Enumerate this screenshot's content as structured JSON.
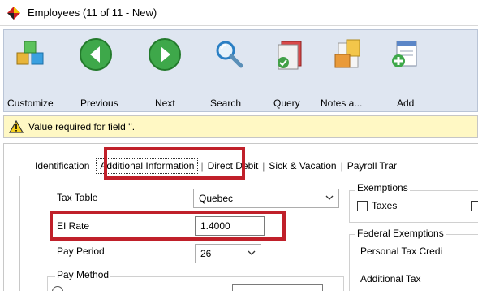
{
  "window": {
    "title": "Employees (11 of 11 - New)"
  },
  "toolbar": {
    "buttons": [
      {
        "label": "Customize",
        "icon": "cubes-icon"
      },
      {
        "label": "Previous",
        "icon": "arrow-left-icon"
      },
      {
        "label": "Next",
        "icon": "arrow-right-icon"
      },
      {
        "label": "Search",
        "icon": "magnifier-icon"
      },
      {
        "label": "Query",
        "icon": "query-icon"
      },
      {
        "label": "Notes a...",
        "icon": "notes-icon"
      },
      {
        "label": "Add",
        "icon": "add-icon"
      }
    ]
  },
  "message": {
    "text": "Value required for field ''."
  },
  "tabs": [
    {
      "label": "Identification"
    },
    {
      "label": "Additional Information"
    },
    {
      "label": "Direct Debit"
    },
    {
      "label": "Sick & Vacation"
    },
    {
      "label": "Payroll Trar"
    }
  ],
  "form": {
    "tax_table_label": "Tax Table",
    "tax_table_value": "Quebec",
    "ei_rate_label": "EI Rate",
    "ei_rate_value": "1.4000",
    "pay_period_label": "Pay Period",
    "pay_period_value": "26",
    "pay_method_label": "Pay Method"
  },
  "exemptions": {
    "title": "Exemptions",
    "taxes_label": "Taxes"
  },
  "federal_exemptions": {
    "title": "Federal Exemptions",
    "personal_tax_credit_label": "Personal Tax Credi",
    "additional_tax_label": "Additional Tax"
  },
  "colors": {
    "toolbar_bg": "#dfe6f1",
    "message_bg": "#fff8c4",
    "highlight": "#c0202a"
  }
}
